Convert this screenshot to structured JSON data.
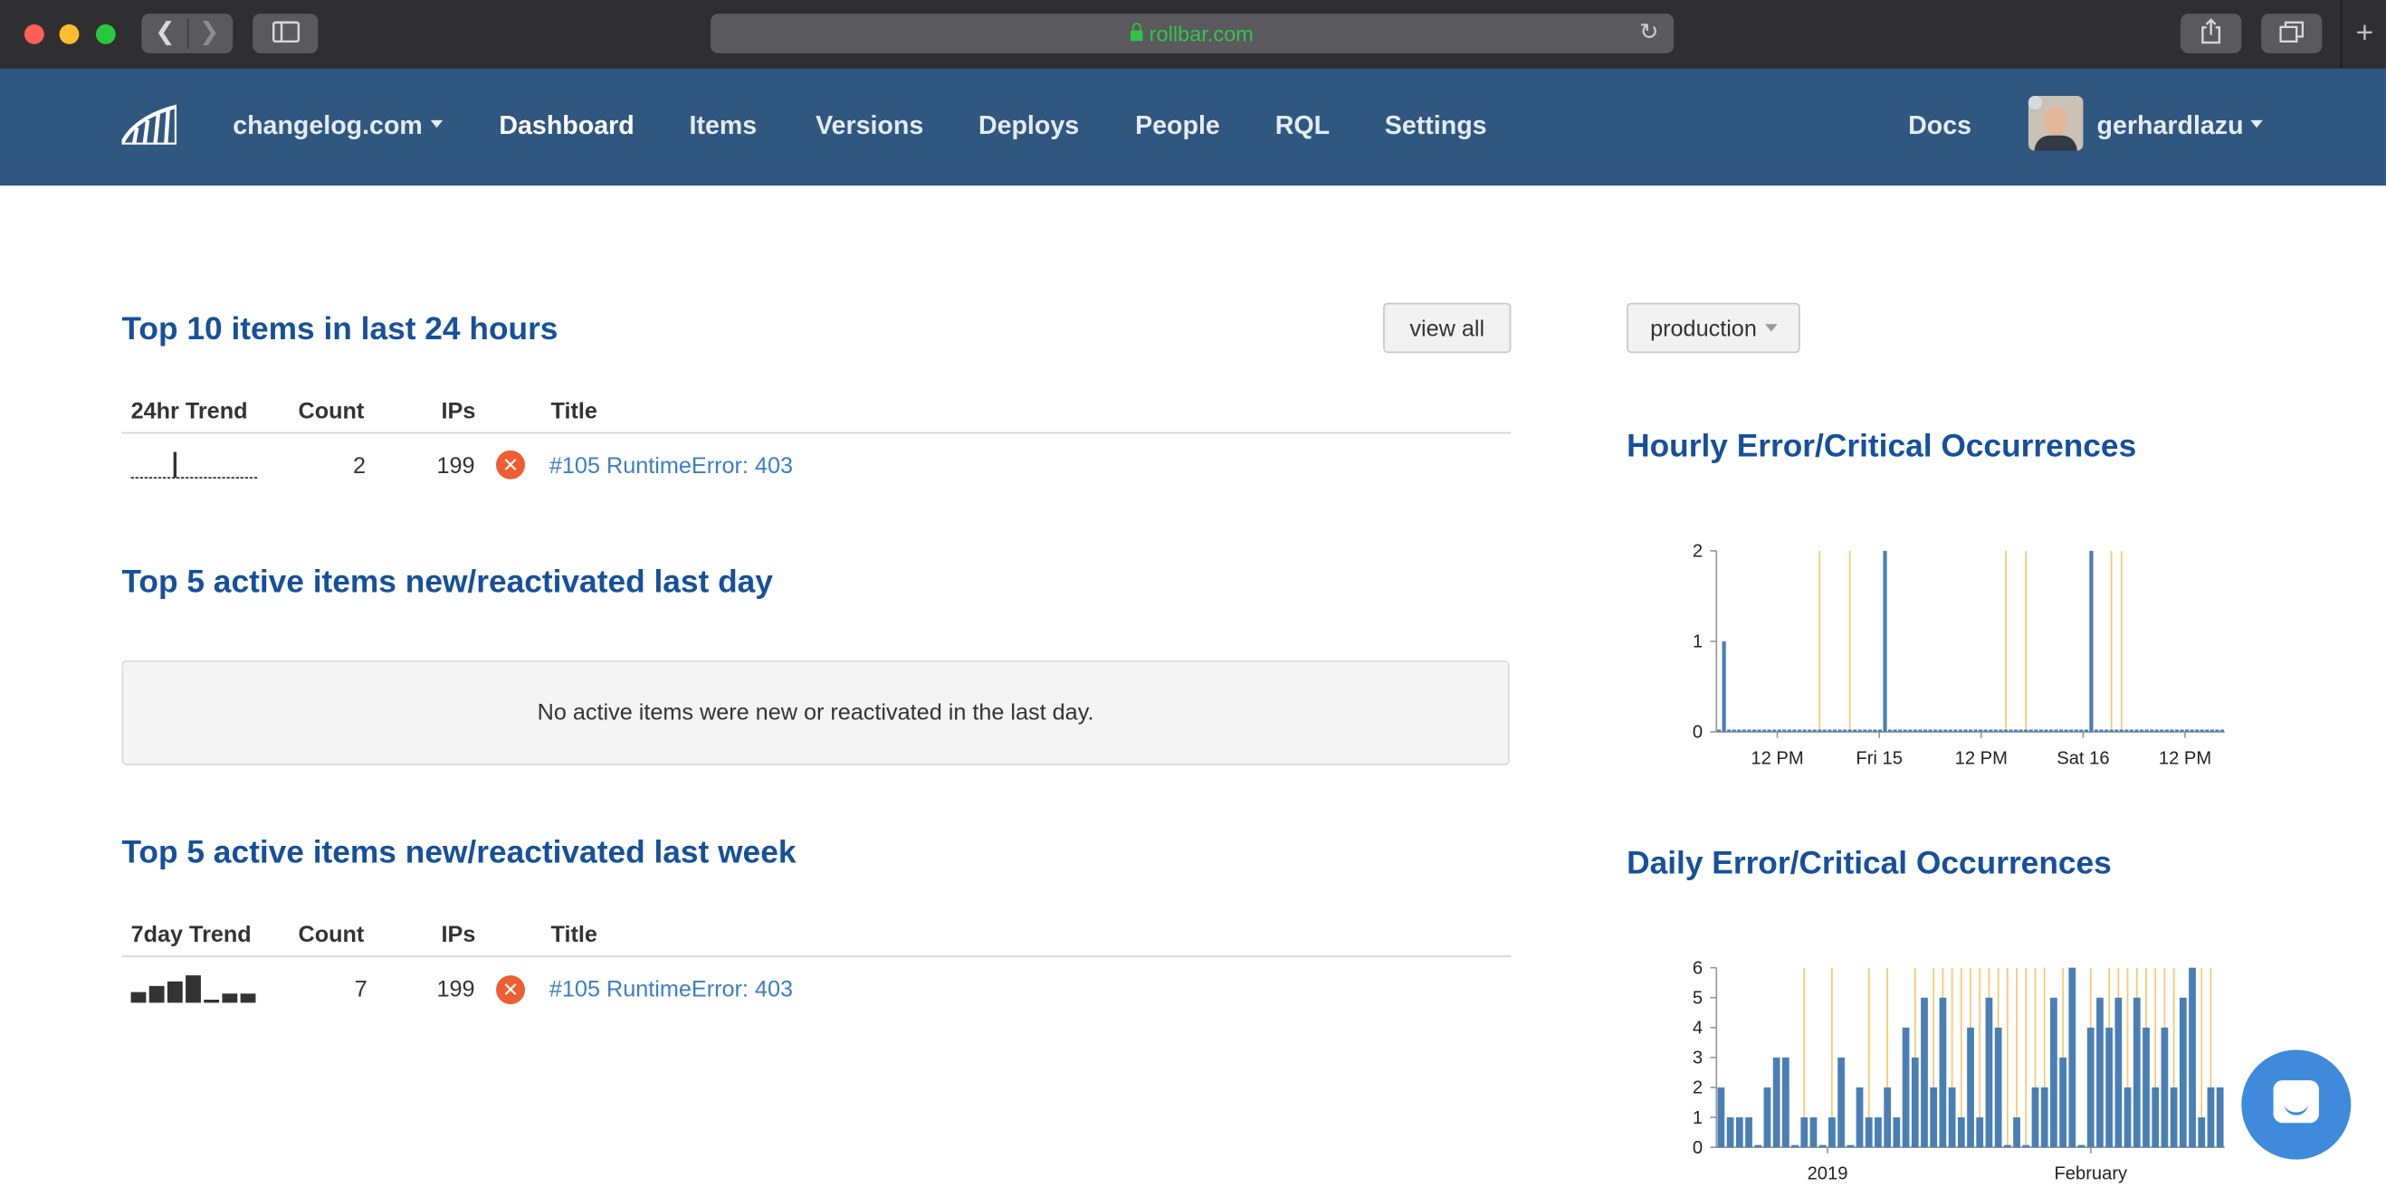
{
  "browser": {
    "url": "rollbar.com",
    "colors": {
      "chrome_bg": "#2f2f31",
      "url_text": "#35c24c"
    }
  },
  "nav": {
    "project": "changelog.com",
    "items": [
      "Dashboard",
      "Items",
      "Versions",
      "Deploys",
      "People",
      "RQL",
      "Settings"
    ],
    "active": "Dashboard",
    "docs": "Docs",
    "user": "gerhardlazu",
    "colors": {
      "bar_bg": "#30577f"
    }
  },
  "top10": {
    "title": "Top 10 items in last 24 hours",
    "view_all": "view all",
    "headers": {
      "trend": "24hr Trend",
      "count": "Count",
      "ips": "IPs",
      "title": "Title"
    },
    "rows": [
      {
        "count": "2",
        "ips": "199",
        "title": "#105 RuntimeError: 403",
        "level": "error"
      }
    ]
  },
  "new_last_day": {
    "title": "Top 5 active items new/reactivated last day",
    "empty_message": "No active items were new or reactivated in the last day."
  },
  "new_last_week": {
    "title": "Top 5 active items new/reactivated last week",
    "headers": {
      "trend": "7day Trend",
      "count": "Count",
      "ips": "IPs",
      "title": "Title"
    },
    "rows": [
      {
        "count": "7",
        "ips": "199",
        "title": "#105 RuntimeError: 403",
        "level": "error"
      }
    ]
  },
  "environment": {
    "selected": "production"
  },
  "colors": {
    "heading": "#17509a",
    "link": "#3c7ec9",
    "error_badge": "#ed5e33",
    "bar": "#4a7fb5",
    "deploy_line": "#f7c76b"
  },
  "chart_data": [
    {
      "type": "bar",
      "title": "Hourly Error/Critical Occurrences",
      "x_ticks": [
        "12 PM",
        "Fri 15",
        "12 PM",
        "Sat 16",
        "12 PM"
      ],
      "ylim": [
        0,
        2
      ],
      "y_ticks": [
        "0",
        "1",
        "2"
      ],
      "values": [
        0,
        1,
        0,
        0,
        0,
        0,
        0,
        0,
        0,
        0,
        0,
        0,
        0,
        0,
        0,
        0,
        0,
        0,
        0,
        0,
        0,
        0,
        0,
        0,
        0,
        0,
        0,
        0,
        0,
        0,
        0,
        0,
        0,
        2,
        0,
        0,
        0,
        0,
        0,
        0,
        0,
        0,
        0,
        0,
        0,
        0,
        0,
        0,
        0,
        0,
        0,
        0,
        0,
        0,
        0,
        0,
        0,
        0,
        0,
        0,
        0,
        0,
        0,
        0,
        0,
        0,
        0,
        0,
        0,
        0,
        0,
        0,
        0,
        0,
        2,
        0,
        0,
        0,
        0,
        0,
        0,
        0,
        0,
        0,
        0,
        0,
        0,
        0,
        0,
        0,
        0,
        0,
        0,
        0,
        0,
        0,
        0,
        0,
        0,
        0,
        0
      ],
      "marker_positions": [
        20,
        26,
        57,
        61,
        78,
        80
      ]
    },
    {
      "type": "bar",
      "title": "Daily Error/Critical Occurrences",
      "x_ticks": [
        "2019",
        "February"
      ],
      "ylim": [
        0,
        6
      ],
      "y_ticks": [
        "0",
        "1",
        "2",
        "3",
        "4",
        "5",
        "6"
      ],
      "values": [
        2,
        1,
        1,
        1,
        0,
        2,
        3,
        3,
        0,
        1,
        1,
        0,
        1,
        3,
        0,
        2,
        1,
        1,
        2,
        1,
        4,
        3,
        5,
        2,
        5,
        2,
        1,
        4,
        1,
        5,
        4,
        0,
        1,
        0,
        2,
        2,
        5,
        3,
        6,
        0,
        4,
        5,
        4,
        5,
        2,
        5,
        4,
        2,
        4,
        2,
        5,
        6,
        1,
        2,
        2
      ],
      "marker_positions": [
        9,
        12,
        16,
        18,
        21,
        23,
        24,
        25,
        26,
        27,
        28,
        29,
        30,
        31,
        32,
        33,
        34,
        35,
        37,
        38,
        40,
        42,
        43,
        44,
        45,
        46,
        47,
        48,
        49,
        51,
        52,
        53
      ]
    }
  ]
}
